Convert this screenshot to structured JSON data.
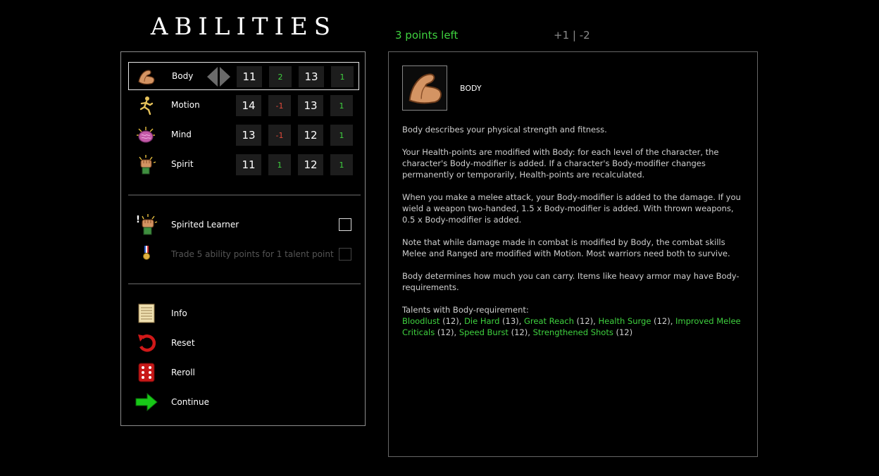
{
  "header": {
    "title": "ABILITIES",
    "points_left": "3 points left",
    "point_mods": "+1 | -2"
  },
  "abilities": [
    {
      "label": "Body",
      "icon": "arm-icon",
      "base": "11",
      "mod1": "2",
      "value": "13",
      "mod2": "1",
      "selected": true
    },
    {
      "label": "Motion",
      "icon": "running-man-icon",
      "base": "14",
      "mod1": "-1",
      "value": "13",
      "mod2": "1"
    },
    {
      "label": "Mind",
      "icon": "brain-icon",
      "base": "13",
      "mod1": "-1",
      "value": "12",
      "mod2": "1"
    },
    {
      "label": "Spirit",
      "icon": "fist-icon",
      "base": "11",
      "mod1": "1",
      "value": "12",
      "mod2": "1"
    }
  ],
  "options": [
    {
      "label": "Spirited Learner",
      "icon": "spirited-fist-icon",
      "checked": false,
      "enabled": true
    },
    {
      "label": "Trade 5 ability points for 1 talent point",
      "icon": "medal-icon",
      "checked": false,
      "enabled": false
    }
  ],
  "menu": [
    {
      "label": "Info",
      "icon": "scroll-icon"
    },
    {
      "label": "Reset",
      "icon": "reset-arrow-icon"
    },
    {
      "label": "Reroll",
      "icon": "dice-icon"
    },
    {
      "label": "Continue",
      "icon": "green-arrow-icon"
    }
  ],
  "info": {
    "title": "BODY",
    "icon": "arm-icon",
    "paragraphs": [
      "Body describes your physical strength and fitness.",
      "Your Health-points are modified with Body: for each level of the character, the character's Body-modifier is added. If a character's Body-modifier changes permanently or temporarily, Health-points are recalculated.",
      "When you make a melee attack, your Body-modifier is added to the damage. If you wield a weapon two-handed, 1.5 x Body-modifier is added. With thrown weapons, 0.5 x Body-modifier is added.",
      "Note that while damage made in combat is modified by Body, the combat skills Melee and Ranged are modified with Motion. Most warriors need both to survive.",
      "Body determines how much you can carry. Items like heavy armor may have Body-requirements."
    ],
    "talents_heading": "Talents with Body-requirement:",
    "talents": [
      {
        "name": "Bloodlust",
        "req": "12"
      },
      {
        "name": "Die Hard",
        "req": "13"
      },
      {
        "name": "Great Reach",
        "req": "12"
      },
      {
        "name": "Health Surge",
        "req": "12"
      },
      {
        "name": "Improved Melee Criticals",
        "req": "12"
      },
      {
        "name": "Speed Burst",
        "req": "12"
      },
      {
        "name": "Strengthened Shots",
        "req": "12"
      }
    ]
  },
  "colors": {
    "positive": "#3fd23f",
    "negative": "#e04a3a",
    "points": "#3fd23f"
  }
}
